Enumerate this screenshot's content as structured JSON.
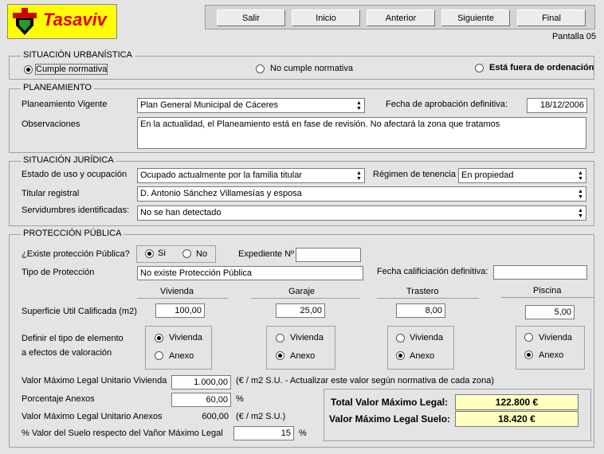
{
  "app": {
    "name": "Tasaviv"
  },
  "nav": {
    "salir": "Salir",
    "inicio": "Inicio",
    "anterior": "Anterior",
    "siguiente": "Siguiente",
    "final": "Final",
    "pantalla": "Pantalla 05"
  },
  "urbanistica": {
    "title": "SITUACIÓN URBANÍSTICA",
    "options": [
      "Cumple normativa",
      "No cumple normativa",
      "Está fuera de ordenación"
    ],
    "selected": "Cumple normativa"
  },
  "planeamiento": {
    "title": "PLANEAMIENTO",
    "vigente_label": "Planeamiento Vigente",
    "vigente_value": "Plan General Municipal de Cáceres",
    "fecha_label": "Fecha de aprobación definitiva:",
    "fecha_value": "18/12/2006",
    "obs_label": "Observaciones",
    "obs_value": "En la actualidad, el Planeamiento está en fase de revisión. No afectará la zona que tratamos"
  },
  "juridica": {
    "title": "SITUACIÓN JURÍDICA",
    "uso_label": "Estado de uso y ocupación",
    "uso_value": "Ocupado actualmente por la familia titular",
    "regimen_label": "Régimen de tenencia",
    "regimen_value": "En propiedad",
    "titular_label": "Titular registral",
    "titular_value": "D. Antonio Sánchez Villamesías y esposa",
    "servidumbres_label": "Servidumbres identificadas:",
    "servidumbres_value": "No se han detectado"
  },
  "proteccion": {
    "title": "PROTECCIÓN PÚBLICA",
    "existe_label": "¿Existe protección Pública?",
    "si": "Si",
    "no": "No",
    "existe_selected": "Si",
    "expediente_label": "Expediente Nº",
    "expediente_value": "",
    "tipo_label": "Tipo de Protección",
    "tipo_value": "No existe Protección Pública",
    "fecha_calif_label": "Fecha calificiación definitiva:",
    "fecha_calif_value": "",
    "columns": [
      "Vivienda",
      "Garaje",
      "Trastero",
      "Piscina"
    ],
    "superficie_label": "Superficie Util Calificada (m2)",
    "superficies": [
      "100,00",
      "25,00",
      "8,00",
      "5,00"
    ],
    "definir_label_1": "Definir el tipo de elemento",
    "definir_label_2": "a efectos de valoración",
    "opt_vivienda": "Vivienda",
    "opt_anexo": "Anexo",
    "tipos_selected": [
      "Vivienda",
      "Anexo",
      "Anexo",
      "Anexo"
    ],
    "vmlu_viv_label": "Valor Máximo Legal Unitario Vivienda",
    "vmlu_viv_value": "1.000,00",
    "vmlu_viv_note": "(€ / m2 S.U.  -  Actualizar este valor según normativa de cada zona)",
    "porc_anexos_label": "Porcentaje Anexos",
    "porc_anexos_value": "60,00",
    "porc_unit": "%",
    "vmlu_anexos_label": "Valor Máximo Legal Unitario Anexos",
    "vmlu_anexos_value": "600,00",
    "vmlu_anexos_unit": "(€ / m2 S.U.)",
    "porc_suelo_label": "% Valor del Suelo respecto del Vañor Máximo Legal",
    "porc_suelo_value": "15",
    "porc_suelo_unit": "%"
  },
  "totals": {
    "total_label": "Total Valor Máximo Legal:",
    "total_value": "122.800 €",
    "suelo_label": "Valor Máximo Legal Suelo:",
    "suelo_value": "18.420 €"
  },
  "colors": {
    "logo_bg": "#ffff00",
    "logo_text": "#e00000",
    "total_bg": "#ffffc0",
    "window_bg": "#e4e4e4"
  }
}
